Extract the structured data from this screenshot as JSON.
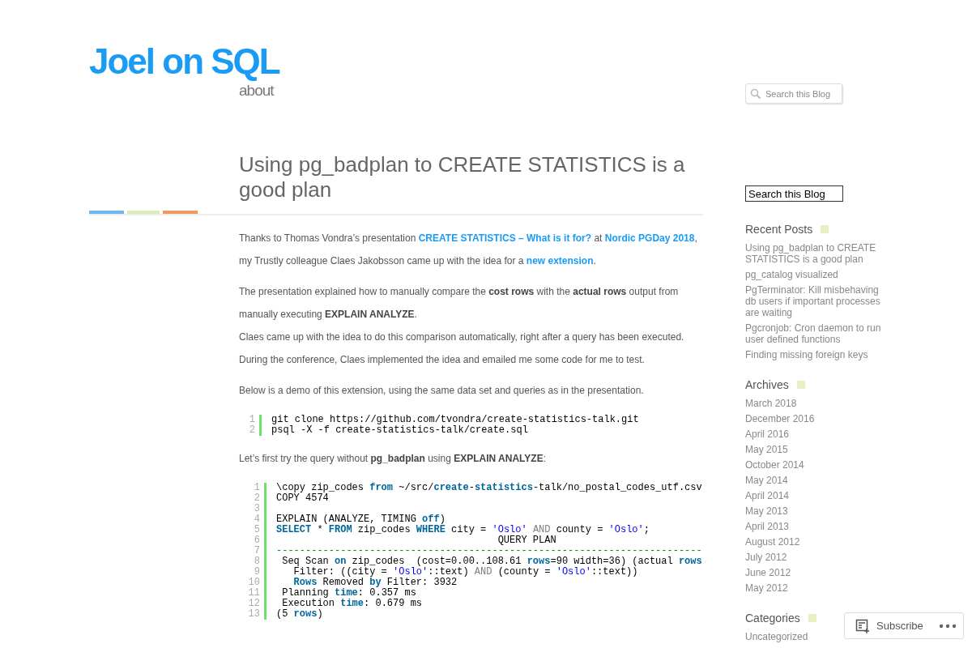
{
  "site": {
    "title": "Joel on SQL",
    "nav": [
      "about"
    ],
    "search_placeholder": "Search this Blog"
  },
  "post": {
    "title": "Using pg_badplan to CREATE STATISTICS is a good plan",
    "body": [
      {
        "kind": "paragraph",
        "parts": [
          {
            "kind": "text",
            "text": "Thanks to Thomas Vondra’s presentation "
          },
          {
            "kind": "link",
            "text": "CREATE STATISTICS – What is it for?"
          },
          {
            "kind": "text",
            "text": " at "
          },
          {
            "kind": "link",
            "text": "Nordic PGDay 2018"
          },
          {
            "kind": "text",
            "text": ", my Trustly colleague Claes Jakobsson came up with the idea for a "
          },
          {
            "kind": "link",
            "text": "new extension"
          },
          {
            "kind": "text",
            "text": "."
          }
        ]
      },
      {
        "kind": "paragraph",
        "parts": [
          {
            "kind": "text",
            "text": "The presentation explained how to manually compare the **cost rows** with the **actual rows** output from manually executing **EXPLAIN ANALYZE**."
          }
        ]
      },
      {
        "kind": "paragraph",
        "parts": [
          {
            "kind": "text",
            "text": "Claes came up with the idea to do this comparison automatically, right after a query has been executed."
          }
        ]
      },
      {
        "kind": "paragraph",
        "parts": [
          {
            "kind": "text",
            "text": "During the conference, Claes implemented the idea and emailed me some code for me to test."
          }
        ]
      },
      {
        "kind": "paragraph",
        "parts": [
          {
            "kind": "text",
            "text": "Below is a demo of this extension, using the same data set and queries as in the presentation."
          }
        ]
      },
      {
        "kind": "code",
        "lines": [
          {
            "number": "1",
            "tokens": [
              {
                "kind": "plain",
                "text": "git clone https://github.com/tvondra/create-statistics-talk.git"
              }
            ]
          },
          {
            "number": "2",
            "tokens": [
              {
                "kind": "plain",
                "text": "psql -X -f create-statistics-talk/create.sql"
              }
            ]
          }
        ]
      },
      {
        "kind": "paragraph",
        "parts": [
          {
            "kind": "text",
            "text": "Let’s first try the query without **pg_badplan** using **EXPLAIN ANALYZE**:"
          }
        ]
      },
      {
        "kind": "code",
        "lines": [
          {
            "number": "1",
            "tokens": [
              {
                "kind": "plain",
                "text": "\\copy zip_codes "
              },
              {
                "kind": "keyword",
                "text": "from"
              },
              {
                "kind": "plain",
                "text": " ~/src/"
              },
              {
                "kind": "keyword",
                "text": "create"
              },
              {
                "kind": "plain",
                "text": "-"
              },
              {
                "kind": "keyword",
                "text": "statistics"
              },
              {
                "kind": "plain",
                "text": "-talk/no_postal_codes_utf.csv"
              }
            ]
          },
          {
            "number": "2",
            "tokens": [
              {
                "kind": "plain",
                "text": "COPY 4574"
              }
            ]
          },
          {
            "number": "3"
          },
          {
            "number": "4",
            "tokens": [
              {
                "kind": "plain",
                "text": "EXPLAIN (ANALYZE, TIMING "
              },
              {
                "kind": "keyword",
                "text": "off"
              },
              {
                "kind": "plain",
                "text": ")"
              }
            ]
          },
          {
            "number": "5",
            "tokens": [
              {
                "kind": "keyword",
                "text": "SELECT"
              },
              {
                "kind": "plain",
                "text": " * "
              },
              {
                "kind": "keyword",
                "text": "FROM"
              },
              {
                "kind": "plain",
                "text": " zip_codes "
              },
              {
                "kind": "keyword",
                "text": "WHERE"
              },
              {
                "kind": "plain",
                "text": " city = "
              },
              {
                "kind": "string",
                "text": "'Oslo'"
              },
              {
                "kind": "operator",
                "text": " AND"
              },
              {
                "kind": "plain",
                "text": " county = "
              },
              {
                "kind": "string",
                "text": "'Oslo'"
              },
              {
                "kind": "plain",
                "text": ";"
              }
            ]
          },
          {
            "number": "6",
            "tokens": [
              {
                "kind": "plain",
                "text": "                                      QUERY PLAN"
              }
            ]
          },
          {
            "number": "7",
            "tokens": [
              {
                "kind": "comment",
                "text": "-------------------------------------------------------------------------"
              }
            ]
          },
          {
            "number": "8",
            "tokens": [
              {
                "kind": "plain",
                "text": " Seq Scan "
              },
              {
                "kind": "keyword",
                "text": "on"
              },
              {
                "kind": "plain",
                "text": " zip_codes  (cost=0.00..108.61 "
              },
              {
                "kind": "keyword",
                "text": "rows"
              },
              {
                "kind": "plain",
                "text": "=90 width=36) (actual "
              },
              {
                "kind": "keyword",
                "text": "rows"
              }
            ]
          },
          {
            "number": "9",
            "tokens": [
              {
                "kind": "plain",
                "text": "   Filter: ((city = "
              },
              {
                "kind": "string",
                "text": "'Oslo'"
              },
              {
                "kind": "plain",
                "text": "::text) "
              },
              {
                "kind": "operator",
                "text": "AND"
              },
              {
                "kind": "plain",
                "text": " (county = "
              },
              {
                "kind": "string",
                "text": "'Oslo'"
              },
              {
                "kind": "plain",
                "text": "::text))"
              }
            ]
          },
          {
            "number": "10",
            "tokens": [
              {
                "kind": "keyword",
                "text": "   Rows"
              },
              {
                "kind": "plain",
                "text": " Removed "
              },
              {
                "kind": "keyword",
                "text": "by"
              },
              {
                "kind": "plain",
                "text": " Filter: 3932"
              }
            ]
          },
          {
            "number": "11",
            "tokens": [
              {
                "kind": "plain",
                "text": " Planning "
              },
              {
                "kind": "keyword",
                "text": "time"
              },
              {
                "kind": "plain",
                "text": ": 0.357 ms"
              }
            ]
          },
          {
            "number": "12",
            "tokens": [
              {
                "kind": "plain",
                "text": " Execution "
              },
              {
                "kind": "keyword",
                "text": "time"
              },
              {
                "kind": "plain",
                "text": ": 0.679 ms"
              }
            ]
          },
          {
            "number": "13",
            "tokens": [
              {
                "kind": "plain",
                "text": "(5 "
              },
              {
                "kind": "keyword",
                "text": "rows"
              },
              {
                "kind": "plain",
                "text": ")"
              }
            ]
          }
        ]
      }
    ]
  },
  "sidebar": {
    "search_value": "Search this Blog",
    "widgets": [
      {
        "title": "Recent Posts",
        "items": [
          "Using pg_badplan to CREATE STATISTICS is a good plan",
          "pg_catalog visualized",
          "PgTerminator: Kill misbehaving db users if important processes are waiting",
          "Pgcronjob: Cron daemon to run user defined functions",
          "Finding missing foreign keys"
        ]
      },
      {
        "title": "Archives",
        "items": [
          "March 2018",
          "December 2016",
          "April 2016",
          "May 2015",
          "October 2014",
          "May 2014",
          "April 2014",
          "May 2013",
          "April 2013",
          "August 2012",
          "July 2012",
          "June 2012",
          "May 2012"
        ]
      },
      {
        "title": "Categories",
        "items": [
          "Uncategorized"
        ]
      }
    ]
  },
  "subscribe": {
    "label": "Subscribe"
  }
}
